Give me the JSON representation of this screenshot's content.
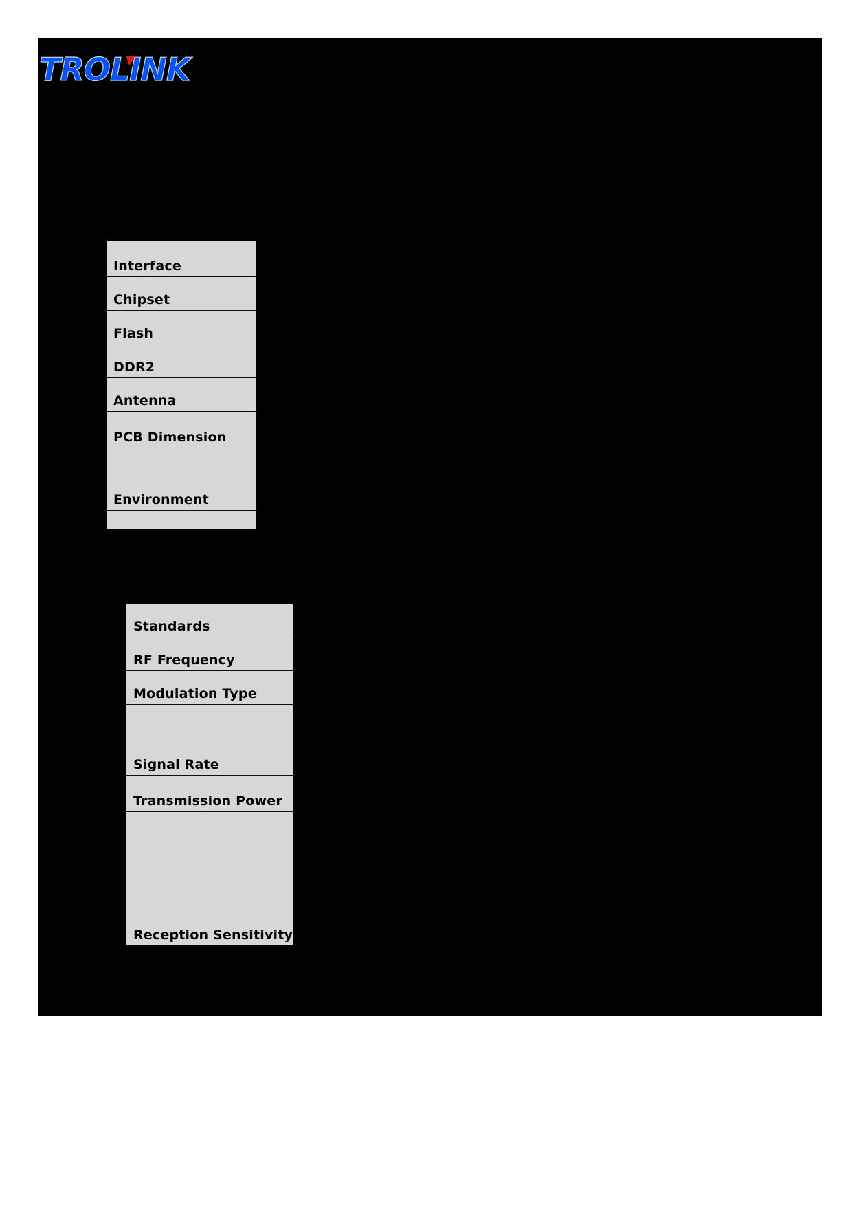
{
  "brand": {
    "name": "TROLINK",
    "primary_color": "#0B53EE",
    "accent_color": "#D42020"
  },
  "page": {
    "background_color": "#000000",
    "table_fill_color": "#D7D7D7"
  },
  "tables": [
    {
      "id": "hardware",
      "name": "hardware-specification-table",
      "rows": [
        {
          "label": "Interface",
          "value": "",
          "height_class": "h48"
        },
        {
          "label": "Chipset",
          "value": "",
          "height_class": "h44"
        },
        {
          "label": "Flash",
          "value": "",
          "height_class": "h44"
        },
        {
          "label": "DDR2",
          "value": "",
          "height_class": "h44"
        },
        {
          "label": "Antenna",
          "value": "",
          "height_class": "h44"
        },
        {
          "label": "PCB Dimension",
          "value": "",
          "height_class": "h48"
        },
        {
          "label": "Environment",
          "value": "",
          "height_class": "h86"
        },
        {
          "label": "",
          "value": "",
          "height_class": "h22"
        }
      ]
    },
    {
      "id": "wireless",
      "name": "wireless-specification-table",
      "rows": [
        {
          "label": "Standards",
          "value": "",
          "height_class": "h44"
        },
        {
          "label": "RF Frequency",
          "value": "",
          "height_class": "h44"
        },
        {
          "label": "Modulation Type",
          "value": "",
          "height_class": "h42"
        },
        {
          "label": "Signal Rate",
          "value": "",
          "height_class": "h98"
        },
        {
          "label": "Transmission Power",
          "value": "",
          "height_class": "h48"
        },
        {
          "label": "Reception Sensitivity",
          "value": "",
          "height_class": "h190"
        }
      ]
    }
  ]
}
